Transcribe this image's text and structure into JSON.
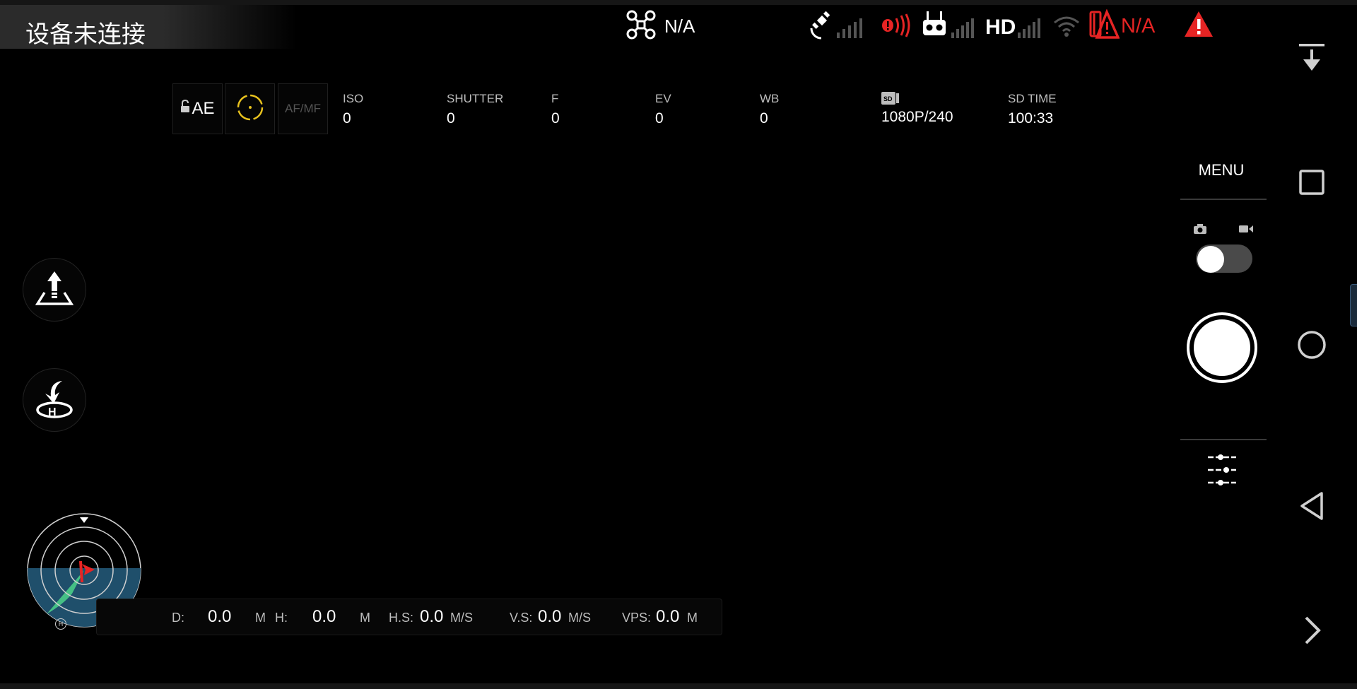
{
  "status_bar": {
    "connection_text": "设备未连接",
    "aircraft_status": "N/A",
    "battery_status": "N/A",
    "hd_label": "HD",
    "icons": [
      "drone-icon",
      "satellite-icon",
      "signal-bars-icon",
      "vibration-alert-icon",
      "remote-controller-icon",
      "hd-link-icon",
      "wifi-icon",
      "battery-warning-icon",
      "warning-triangle-icon"
    ]
  },
  "camera_params": {
    "ae_label": "AE",
    "afmf_label": "AF/MF",
    "iso": {
      "label": "ISO",
      "value": "0"
    },
    "shutter": {
      "label": "SHUTTER",
      "value": "0"
    },
    "f": {
      "label": "F",
      "value": "0"
    },
    "ev": {
      "label": "EV",
      "value": "0"
    },
    "wb": {
      "label": "WB",
      "value": "0"
    },
    "resolution": {
      "icon": "sd-card-icon",
      "value": "1080P/240"
    },
    "sd_time": {
      "label": "SD TIME",
      "value": "100:33"
    }
  },
  "telemetry": {
    "d": {
      "label": "D:",
      "value": "0.0",
      "unit": "M"
    },
    "h": {
      "label": "H:",
      "value": "0.0",
      "unit": "M"
    },
    "hs": {
      "label": "H.S:",
      "value": "0.0",
      "unit": "M/S"
    },
    "vs": {
      "label": "V.S:",
      "value": "0.0",
      "unit": "M/S"
    },
    "vps": {
      "label": "VPS:",
      "value": "0.0",
      "unit": "M"
    }
  },
  "radar": {
    "home_marker": "H"
  },
  "right_panel": {
    "menu_label": "MENU",
    "mode_selected": "photo"
  },
  "colors": {
    "accent_yellow": "#e8c21e",
    "alert_red": "#e62424",
    "radar_water": "#1f4f6b",
    "radar_cone": "#4cd38a"
  }
}
